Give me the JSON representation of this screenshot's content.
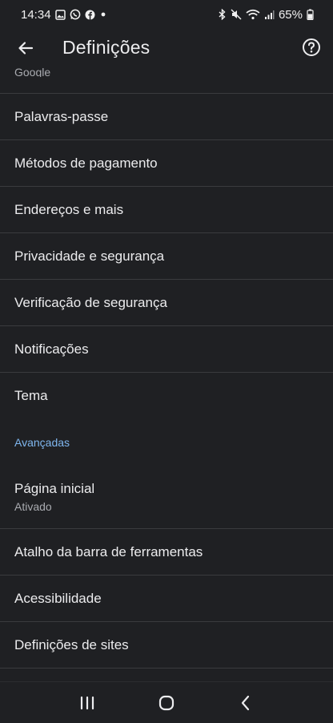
{
  "status_bar": {
    "time": "14:34",
    "battery": "65%",
    "left_icons": [
      "gallery-icon",
      "whatsapp-icon",
      "facebook-icon",
      "dot-icon"
    ],
    "right_icons": [
      "bluetooth-icon",
      "mute-icon",
      "wifi-icon",
      "signal-icon",
      "battery-icon"
    ]
  },
  "app_bar": {
    "title": "Definições"
  },
  "list": {
    "cutoff_label": "Google",
    "items": [
      {
        "label": "Palavras-passe"
      },
      {
        "label": "Métodos de pagamento"
      },
      {
        "label": "Endereços e mais"
      },
      {
        "label": "Privacidade e segurança"
      },
      {
        "label": "Verificação de segurança"
      },
      {
        "label": "Notificações"
      },
      {
        "label": "Tema"
      }
    ],
    "section_header": "Avançadas",
    "advanced_items": [
      {
        "label": "Página inicial",
        "sub": "Ativado"
      },
      {
        "label": "Atalho da barra de ferramentas"
      },
      {
        "label": "Acessibilidade"
      },
      {
        "label": "Definições de sites"
      }
    ]
  },
  "nav_bar": {
    "buttons": [
      "recents-icon",
      "home-icon",
      "back-nav-icon"
    ]
  },
  "colors": {
    "background": "#1f2023",
    "divider": "#3a3b3e",
    "accent": "#7fb6ee",
    "text": "#ececee",
    "subtext": "#a9abb0"
  }
}
